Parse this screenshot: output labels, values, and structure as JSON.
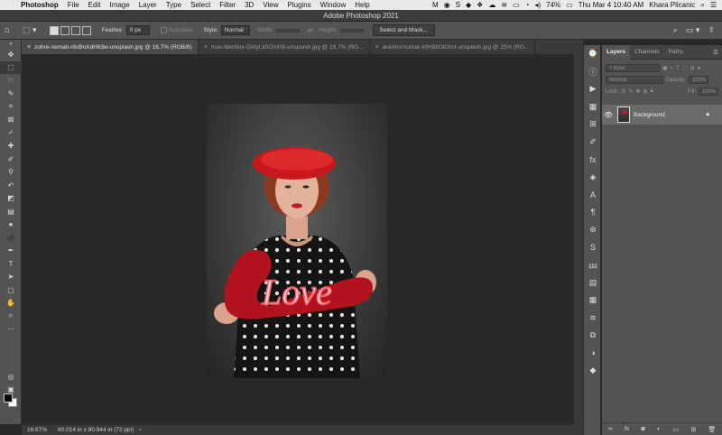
{
  "menubar": {
    "items": [
      "Photoshop",
      "File",
      "Edit",
      "Image",
      "Layer",
      "Type",
      "Select",
      "Filter",
      "3D",
      "View",
      "Plugins",
      "Window",
      "Help"
    ],
    "battery": "74%",
    "datetime": "Thu Mar 4  10:40 AM",
    "user": "Khara Plicanic"
  },
  "titlebar": {
    "title": "Adobe Photoshop 2021"
  },
  "options": {
    "feather_label": "Feather:",
    "feather_value": "0 px",
    "antialias_label": "Anti-alias",
    "style_label": "Style:",
    "style_value": "Normal",
    "width_label": "Width:",
    "height_label": "Height:",
    "select_mask_label": "Select and Mask..."
  },
  "tabs": [
    {
      "label": "zohre-nemati-r8sBnXdH63w-unsplash.jpg @ 16.7% (RGB/8)",
      "close": "×"
    },
    {
      "label": "max-libertine-GbtyLk5OmH8-unsplash.jpg @ 16.7% (RG...",
      "close": "×"
    },
    {
      "label": "aravind-kumar-k9H8itO83mI-unsplash.jpg @ 25% (RG...",
      "close": "×"
    }
  ],
  "status": {
    "zoom": "16.67%",
    "doc_size": "60.014 in x 90.944 in (72 ppi)"
  },
  "panel": {
    "tabs": [
      "Layers",
      "Channels",
      "Paths"
    ],
    "kind_placeholder": "Kind",
    "blend_mode": "Normal",
    "opacity_label": "Opacity:",
    "opacity_value": "100%",
    "lock_label": "Lock:",
    "fill_label": "Fill:",
    "fill_value": "100%",
    "layer_name": "Background"
  },
  "sign_text": "Love",
  "colors": {
    "accent_red": "#c8171d",
    "panel_bg": "#535353",
    "canvas_bg": "#282828"
  }
}
